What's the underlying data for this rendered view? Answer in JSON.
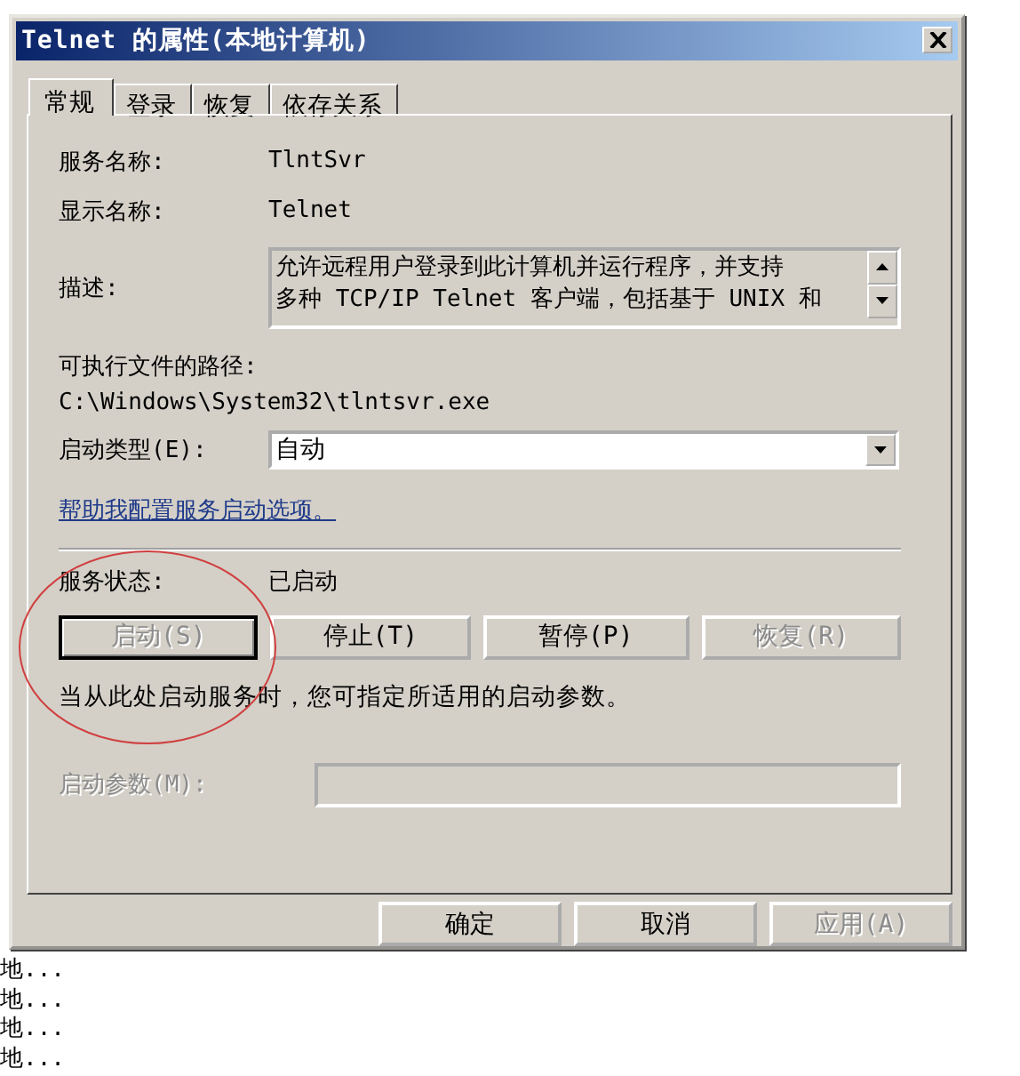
{
  "background_items": [
    "地...",
    "地...",
    "地...",
    "地..."
  ],
  "window": {
    "title": "Telnet 的属性(本地计算机)"
  },
  "tabs": [
    {
      "label": "常规",
      "selected": true
    },
    {
      "label": "登录",
      "selected": false
    },
    {
      "label": "恢复",
      "selected": false
    },
    {
      "label": "依存关系",
      "selected": false
    }
  ],
  "service_name": {
    "label": "服务名称:",
    "value": "TlntSvr"
  },
  "display_name": {
    "label": "显示名称:",
    "value": "Telnet"
  },
  "description": {
    "label": "描述:",
    "lines": [
      "允许远程用户登录到此计算机并运行程序，并支持",
      "多种 TCP/IP Telnet 客户端，包括基于 UNIX 和"
    ]
  },
  "executable_path": {
    "label": "可执行文件的路径:",
    "value": "C:\\Windows\\System32\\tlntsvr.exe"
  },
  "startup_type": {
    "label": "启动类型(E):",
    "value": "自动"
  },
  "help_link": "帮助我配置服务启动选项。",
  "service_status": {
    "label": "服务状态:",
    "value": "已启动"
  },
  "service_buttons": [
    {
      "label": "启动(S)",
      "disabled": true,
      "focused": true
    },
    {
      "label": "停止(T)",
      "disabled": false,
      "focused": false
    },
    {
      "label": "暂停(P)",
      "disabled": false,
      "focused": false
    },
    {
      "label": "恢复(R)",
      "disabled": true,
      "focused": false
    }
  ],
  "start_hint": "当从此处启动服务时，您可指定所适用的启动参数。",
  "start_parameters": {
    "label": "启动参数(M):",
    "disabled": true
  },
  "dialog_buttons": [
    {
      "label": "确定",
      "disabled": false
    },
    {
      "label": "取消",
      "disabled": false
    },
    {
      "label": "应用(A)",
      "disabled": true
    }
  ]
}
